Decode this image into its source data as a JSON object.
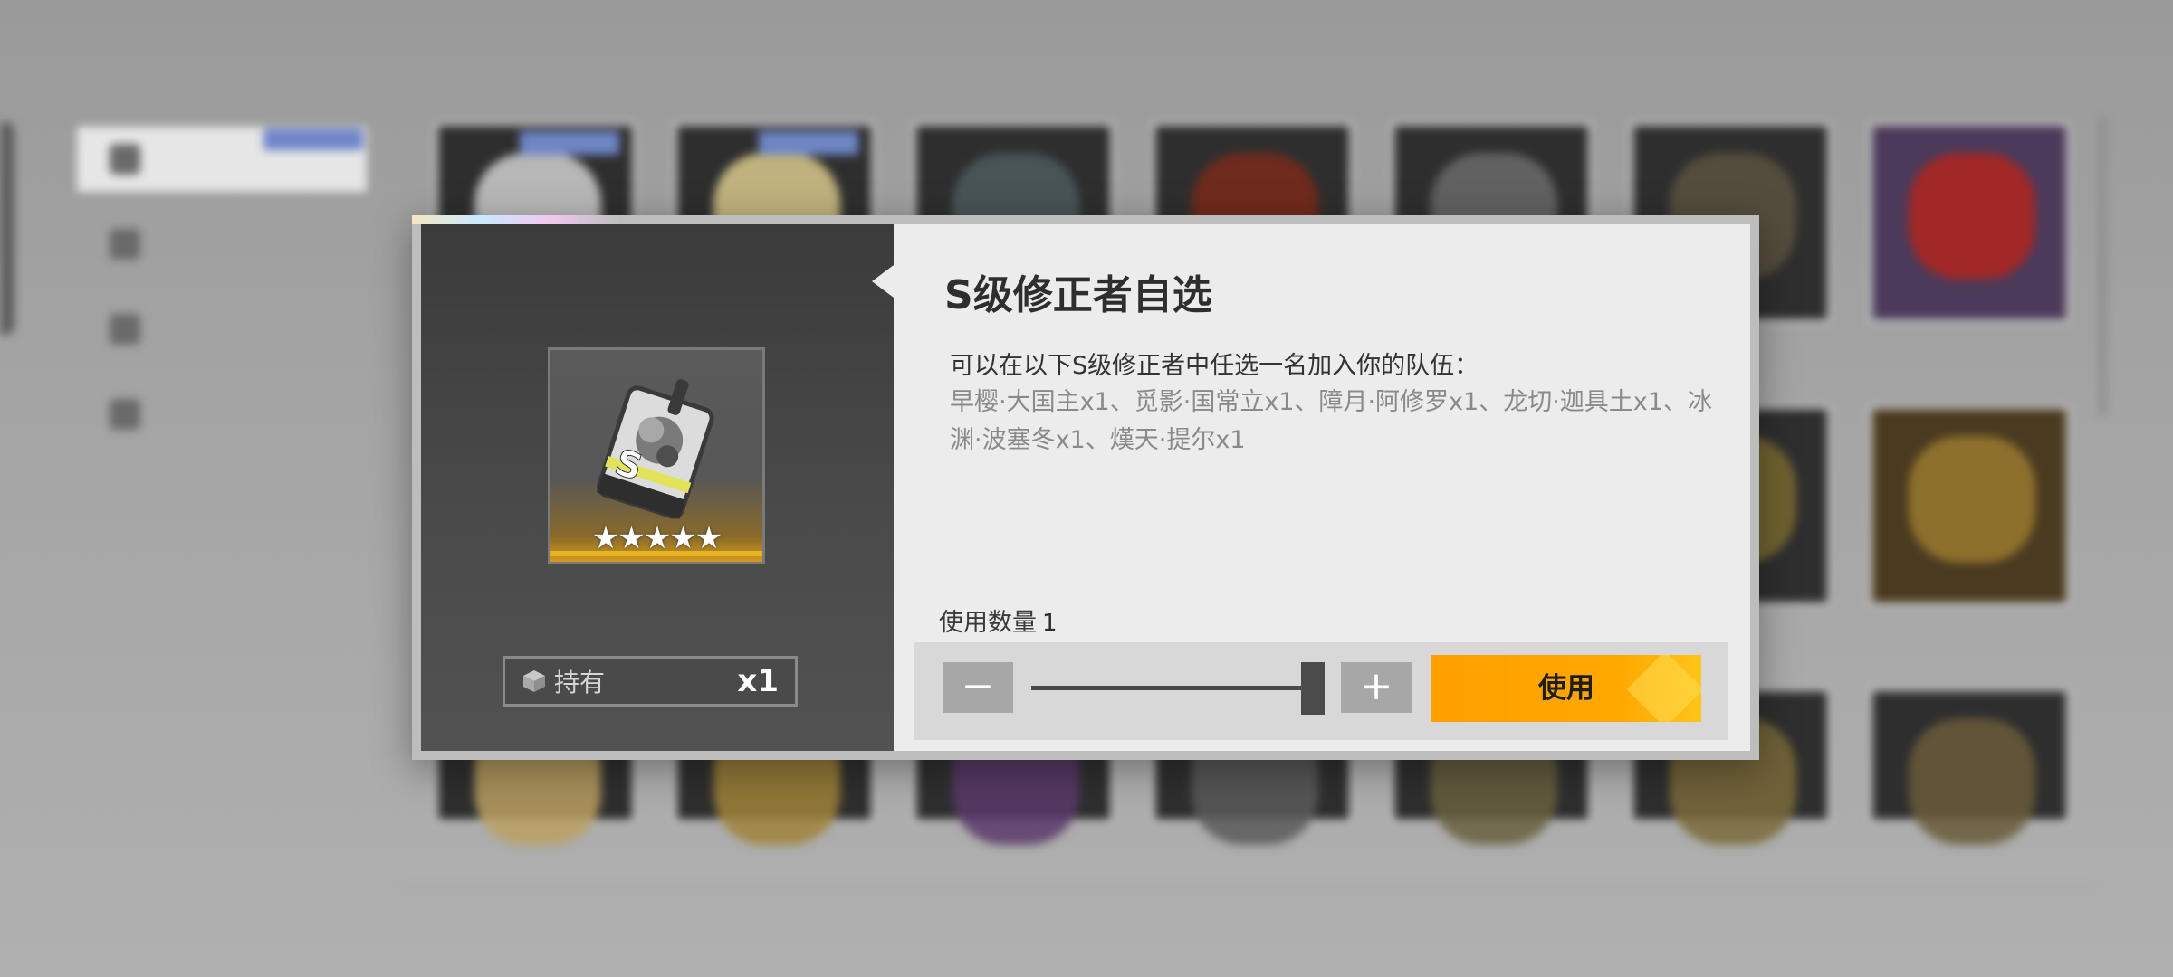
{
  "popup": {
    "title": "S级修正者自选",
    "description": "可以在以下S级修正者中任选一名加入你的队伍：",
    "options_text": "早樱·大国主x1、觅影·国常立x1、障月·阿修罗x1、龙切·迦具土x1、冰渊·波塞冬x1、熯天·提尔x1",
    "owned_label": "持有",
    "owned_count": "x1",
    "item_stars": "★★★★★",
    "quantity_label": "使用数量",
    "quantity_value": "1",
    "minus_label": "−",
    "plus_label": "+",
    "use_button": "使用"
  },
  "colors": {
    "accent": "#ffa000",
    "item_rarity": "#e8b320"
  },
  "icons": {
    "owned": "box-icon",
    "item": "s-rank-badge"
  }
}
